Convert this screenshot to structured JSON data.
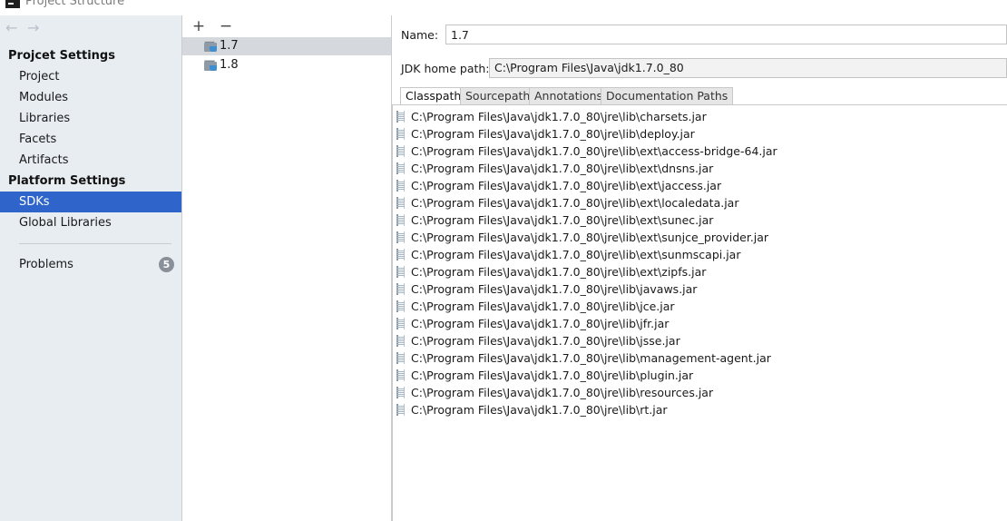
{
  "window": {
    "title": "Project Structure"
  },
  "nav": {
    "back_arrow": "←",
    "forward_arrow": "→",
    "project_settings_title": "Projcet Settings",
    "project_settings_items": [
      "Project",
      "Modules",
      "Libraries",
      "Facets",
      "Artifacts"
    ],
    "platform_settings_title": "Platform Settings",
    "platform_settings_items": [
      "SDKs",
      "Global Libraries"
    ],
    "selected_item": "SDKs",
    "problems_label": "Problems",
    "problems_count": "5"
  },
  "sdk_list": {
    "add_label": "+",
    "remove_label": "−",
    "items": [
      "1.7",
      "1.8"
    ],
    "selected": "1.7"
  },
  "details": {
    "name_label": "Name:",
    "name_value": "1.7",
    "jdk_home_label": "JDK home path:",
    "jdk_home_value": "C:\\Program Files\\Java\\jdk1.7.0_80",
    "tabs": [
      "Classpath",
      "Sourcepath",
      "Annotations",
      "Documentation Paths"
    ],
    "active_tab": "Classpath",
    "classpath": [
      "C:\\Program Files\\Java\\jdk1.7.0_80\\jre\\lib\\charsets.jar",
      "C:\\Program Files\\Java\\jdk1.7.0_80\\jre\\lib\\deploy.jar",
      "C:\\Program Files\\Java\\jdk1.7.0_80\\jre\\lib\\ext\\access-bridge-64.jar",
      "C:\\Program Files\\Java\\jdk1.7.0_80\\jre\\lib\\ext\\dnsns.jar",
      "C:\\Program Files\\Java\\jdk1.7.0_80\\jre\\lib\\ext\\jaccess.jar",
      "C:\\Program Files\\Java\\jdk1.7.0_80\\jre\\lib\\ext\\localedata.jar",
      "C:\\Program Files\\Java\\jdk1.7.0_80\\jre\\lib\\ext\\sunec.jar",
      "C:\\Program Files\\Java\\jdk1.7.0_80\\jre\\lib\\ext\\sunjce_provider.jar",
      "C:\\Program Files\\Java\\jdk1.7.0_80\\jre\\lib\\ext\\sunmscapi.jar",
      "C:\\Program Files\\Java\\jdk1.7.0_80\\jre\\lib\\ext\\zipfs.jar",
      "C:\\Program Files\\Java\\jdk1.7.0_80\\jre\\lib\\javaws.jar",
      "C:\\Program Files\\Java\\jdk1.7.0_80\\jre\\lib\\jce.jar",
      "C:\\Program Files\\Java\\jdk1.7.0_80\\jre\\lib\\jfr.jar",
      "C:\\Program Files\\Java\\jdk1.7.0_80\\jre\\lib\\jsse.jar",
      "C:\\Program Files\\Java\\jdk1.7.0_80\\jre\\lib\\management-agent.jar",
      "C:\\Program Files\\Java\\jdk1.7.0_80\\jre\\lib\\plugin.jar",
      "C:\\Program Files\\Java\\jdk1.7.0_80\\jre\\lib\\resources.jar",
      "C:\\Program Files\\Java\\jdk1.7.0_80\\jre\\lib\\rt.jar"
    ]
  },
  "colors": {
    "nav_background": "#e8edf2",
    "selection_blue": "#2f65ca",
    "list_selection_gray": "#d5d8dc",
    "badge_gray": "#8a9099"
  },
  "icons": {
    "app": "intellij-app-icon",
    "sdk": "jdk-folder-icon",
    "classpath_entry": "jar-archive-icon"
  }
}
